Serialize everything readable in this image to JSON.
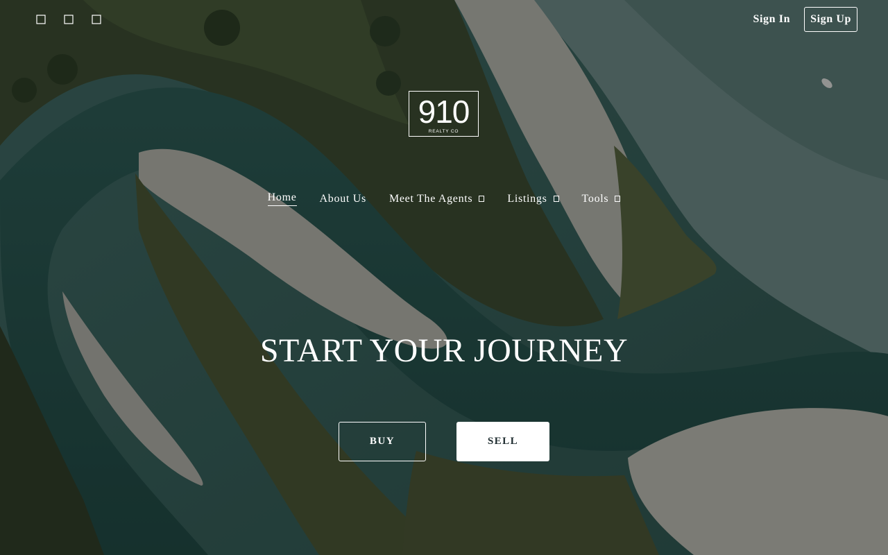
{
  "social": {
    "icons": [
      "facebook-icon",
      "instagram-icon",
      "linkedin-icon"
    ]
  },
  "auth": {
    "sign_in": "Sign In",
    "sign_up": "Sign Up"
  },
  "logo": {
    "number": "910",
    "subtitle": "REALTY CO"
  },
  "nav": {
    "items": [
      {
        "label": "Home",
        "active": true,
        "has_dropdown": false
      },
      {
        "label": "About Us",
        "active": false,
        "has_dropdown": false
      },
      {
        "label": "Meet The Agents",
        "active": false,
        "has_dropdown": true
      },
      {
        "label": "Listings",
        "active": false,
        "has_dropdown": true
      },
      {
        "label": "Tools",
        "active": false,
        "has_dropdown": true
      }
    ]
  },
  "hero": {
    "headline": "START YOUR JOURNEY",
    "buy_label": "BUY",
    "sell_label": "SELL"
  },
  "colors": {
    "text": "#ffffff",
    "sell_text": "#1d2b2e",
    "overlay": "rgba(10,14,16,0.38)"
  }
}
